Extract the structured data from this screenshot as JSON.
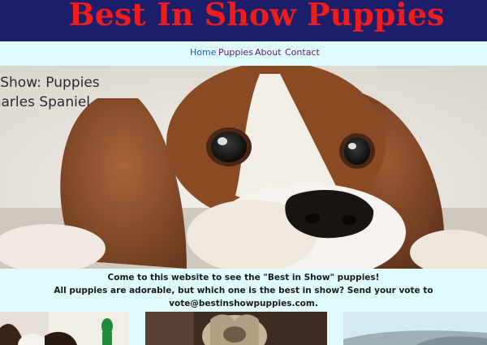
{
  "site": {
    "title": "Best In Show Puppies"
  },
  "nav": {
    "items": [
      {
        "label": "Home"
      },
      {
        "label": "Puppies"
      },
      {
        "label": "About"
      },
      {
        "label": "Contact"
      }
    ]
  },
  "hero": {
    "caption_line1": "Best In Show: Puppies",
    "caption_line2": "King Charles Spaniel"
  },
  "intro": {
    "line1": "Come to this website to see the \"Best in Show\" puppies!",
    "line2": "All puppies are adorable, but which one is the best in show? Send your vote to vote@bestinshowpuppies.com."
  },
  "colors": {
    "header_bg": "#1b1f6b",
    "title_red": "#f01c1c",
    "page_bg": "#dffbfb"
  }
}
